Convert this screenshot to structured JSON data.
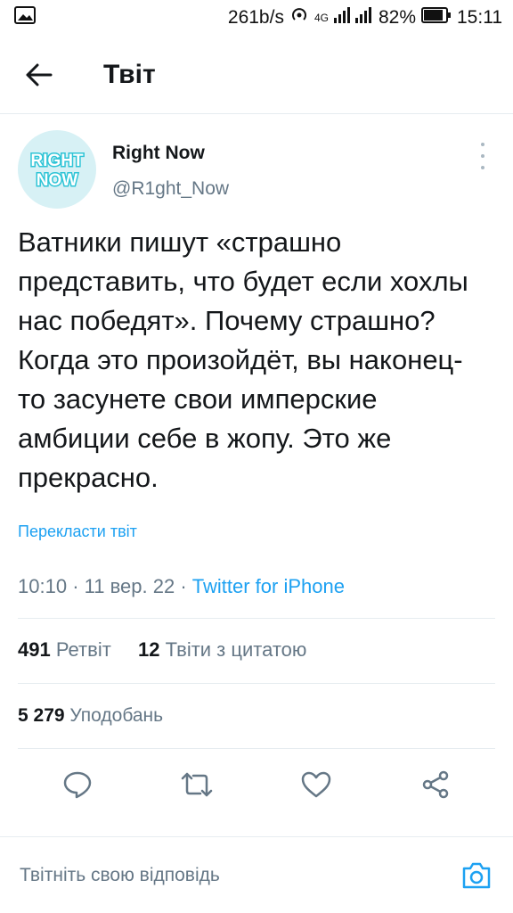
{
  "status_bar": {
    "speed": "261b/s",
    "network": "4G",
    "battery": "82%",
    "time": "15:11"
  },
  "header": {
    "title": "Твіт",
    "back_icon": "arrow-left-icon"
  },
  "tweet": {
    "avatar_text_line1": "RIGHT",
    "avatar_text_line2": "NOW",
    "author_name": "Right Now",
    "author_handle": "@R1ght_Now",
    "text": "Ватники пишут «страшно представить, что будет если хохлы нас победят». Почему страшно? Когда это произойдёт, вы наконец-то засунете свои имперские амбиции себе в жопу. Это же прекрасно.",
    "translate_label": "Перекласти твіт",
    "time": "10:10",
    "date": "11 вер. 22",
    "source": "Twitter for iPhone",
    "separator": "·"
  },
  "stats": {
    "retweets_count": "491",
    "retweets_label": "Ретвіт",
    "quotes_count": "12",
    "quotes_label": "Твіти з цитатою",
    "likes_count": "5 279",
    "likes_label": "Уподобань"
  },
  "actions": {
    "icons": [
      "reply-icon",
      "retweet-icon",
      "like-icon",
      "share-icon"
    ]
  },
  "reply": {
    "placeholder": "Твітніть свою відповідь",
    "camera_icon": "camera-icon"
  },
  "colors": {
    "accent": "#1da1f2",
    "secondary_text": "#657786",
    "divider": "#e6ecf0",
    "avatar_bg": "#d7f1f5",
    "avatar_brand": "#2ec4d6"
  }
}
